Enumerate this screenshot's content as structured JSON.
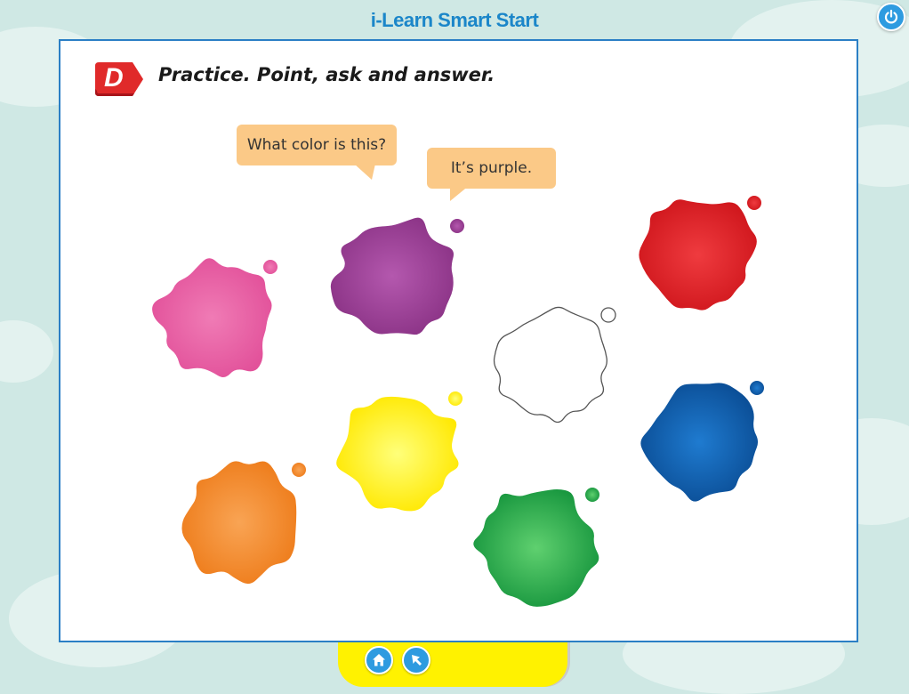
{
  "header": {
    "app_title": "i-Learn Smart Start",
    "power_icon": "power-icon"
  },
  "activity": {
    "badge_letter": "D",
    "instruction": "Practice. Point, ask and answer.",
    "question_bubble": "What color is this?",
    "answer_bubble": "It’s purple.",
    "splats": [
      {
        "color_name": "pink",
        "hex": "#ea5b9f"
      },
      {
        "color_name": "purple",
        "hex": "#9c3d97"
      },
      {
        "color_name": "red",
        "hex": "#e31e24"
      },
      {
        "color_name": "white",
        "hex": "#ffffff"
      },
      {
        "color_name": "blue",
        "hex": "#0e5aa7"
      },
      {
        "color_name": "yellow",
        "hex": "#fff100"
      },
      {
        "color_name": "orange",
        "hex": "#f4892a"
      },
      {
        "color_name": "green",
        "hex": "#1fa64a"
      }
    ]
  },
  "footer": {
    "home_icon": "home-icon",
    "back_icon": "back-arrow-icon"
  },
  "colors": {
    "title_blue": "#1b86c9",
    "panel_border": "#2b7fc5",
    "bubble": "#fbc987",
    "badge_red": "#e02a2a",
    "bottom_bar": "#fff200"
  }
}
